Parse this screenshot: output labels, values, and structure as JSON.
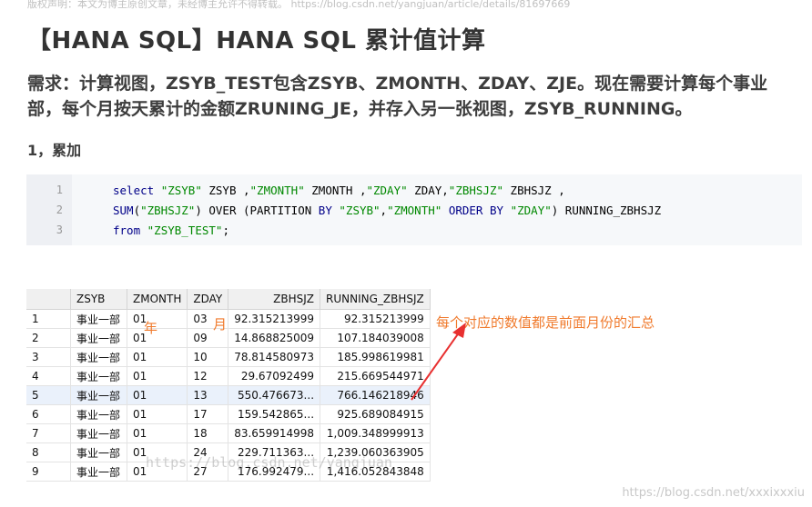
{
  "article": {
    "notice": "版权声明：本文为博主原创文章，未经博主允许不得转载。 https://blog.csdn.net/yangjuan/article/details/81697669",
    "title": "【HANA SQL】HANA SQL 累计值计算",
    "requirement": "需求：计算视图，ZSYB_TEST包含ZSYB、ZMONTH、ZDAY、ZJE。现在需要计算每个事业部，每个月按天累计的金额ZRUNING_JE，并存入另一张视图，ZSYB_RUNNING。",
    "section": "1，累加"
  },
  "code": {
    "line_numbers": [
      "1",
      "2",
      "3"
    ]
  },
  "table": {
    "columns": [
      "",
      "ZSYB",
      "ZMONTH",
      "ZDAY",
      "ZBHSJZ",
      "RUNNING_ZBHSJZ"
    ],
    "rows": [
      [
        "1",
        "事业一部",
        "01",
        "03",
        "92.315213999",
        "92.315213999"
      ],
      [
        "2",
        "事业一部",
        "01",
        "09",
        "14.868825009",
        "107.184039008"
      ],
      [
        "3",
        "事业一部",
        "01",
        "10",
        "78.814580973",
        "185.998619981"
      ],
      [
        "4",
        "事业一部",
        "01",
        "12",
        "29.67092499",
        "215.669544971"
      ],
      [
        "5",
        "事业一部",
        "01",
        "13",
        "550.476673...",
        "766.146218946"
      ],
      [
        "6",
        "事业一部",
        "01",
        "17",
        "159.542865...",
        "925.689084915"
      ],
      [
        "7",
        "事业一部",
        "01",
        "18",
        "83.659914998",
        "1,009.348999913"
      ],
      [
        "8",
        "事业一部",
        "01",
        "24",
        "229.711363...",
        "1,239.060363905"
      ],
      [
        "9",
        "事业一部",
        "01",
        "27",
        "176.992479...",
        "1,416.052843848"
      ]
    ]
  },
  "annotations": {
    "year": "年",
    "month": "月",
    "note": "每个对应的数值都是前面月份的汇总",
    "color": "#f07a2c"
  },
  "watermarks": {
    "overlay": "https://blog.csdn.net/yangjuan",
    "corner": "https://blog.csdn.net/xxxixxxiu"
  }
}
